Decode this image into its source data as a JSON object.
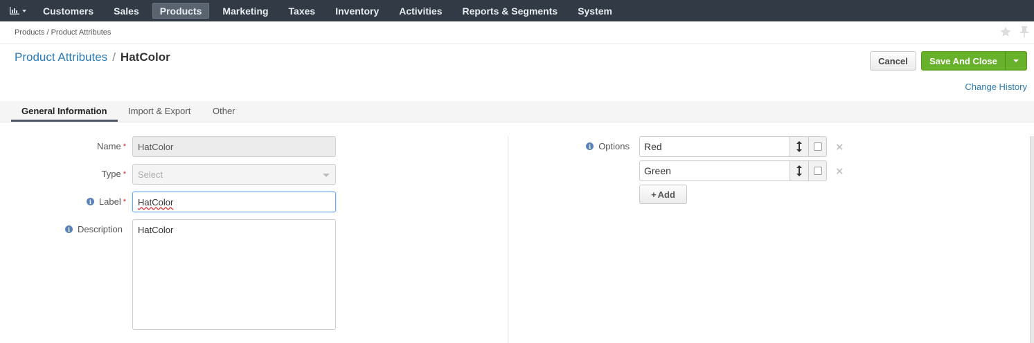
{
  "nav": {
    "items": [
      {
        "label": "Customers",
        "active": false
      },
      {
        "label": "Sales",
        "active": false
      },
      {
        "label": "Products",
        "active": true
      },
      {
        "label": "Marketing",
        "active": false
      },
      {
        "label": "Taxes",
        "active": false
      },
      {
        "label": "Inventory",
        "active": false
      },
      {
        "label": "Activities",
        "active": false
      },
      {
        "label": "Reports & Segments",
        "active": false
      },
      {
        "label": "System",
        "active": false
      }
    ]
  },
  "breadcrumb": "Products / Product Attributes",
  "title": {
    "parent": "Product Attributes",
    "separator": "/",
    "current": "HatColor"
  },
  "actions": {
    "cancel": "Cancel",
    "save": "Save And Close",
    "change_history": "Change History"
  },
  "tabs": [
    "General Information",
    "Import & Export",
    "Other"
  ],
  "form": {
    "name_label": "Name",
    "name_value": "HatColor",
    "type_label": "Type",
    "type_placeholder": "Select",
    "label_label": "Label",
    "label_value": "HatColor",
    "description_label": "Description",
    "description_value": "HatColor",
    "required_mark": "*"
  },
  "options": {
    "label": "Options",
    "items": [
      "Red",
      "Green"
    ],
    "add_label": "Add"
  },
  "colors": {
    "nav_bg": "#313a45",
    "accent_link": "#2a7ab8",
    "save_green": "#67b22a"
  }
}
